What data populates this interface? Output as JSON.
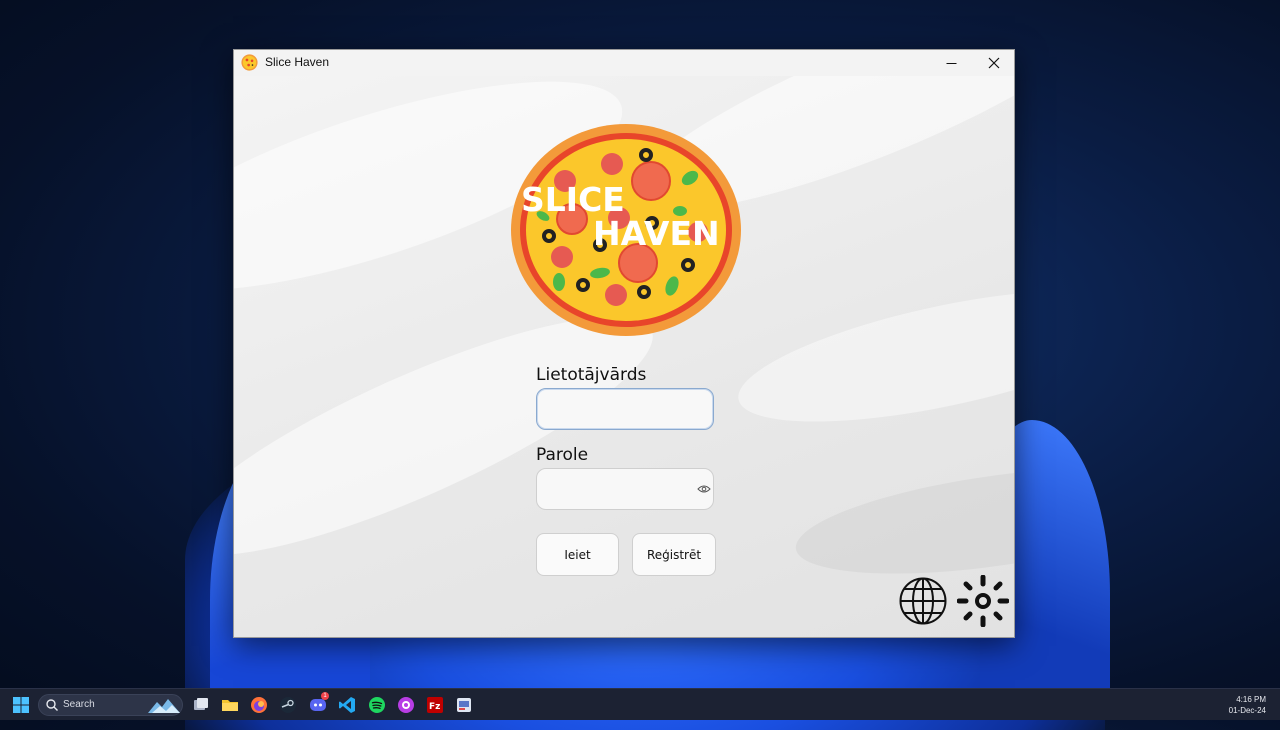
{
  "window": {
    "title": "Slice Haven",
    "minimize_symbol": "—",
    "close_symbol": "✕"
  },
  "logo": {
    "line1": "SLICE",
    "line2": "HAVEN"
  },
  "form": {
    "username_label": "Lietotājvārds",
    "username_value": "",
    "password_label": "Parole",
    "password_value": "",
    "login_button": "Ieiet",
    "register_button": "Reģistrēt"
  },
  "settings": {
    "language_icon": "globe-icon",
    "theme_icon": "sun-icon"
  },
  "taskbar": {
    "search_placeholder": "Search",
    "time": "4:16 PM",
    "date": "01-Dec-24",
    "discord_badge": "1",
    "apps": [
      "start-icon",
      "task-view-icon",
      "file-explorer-icon",
      "firefox-icon",
      "steam-icon",
      "discord-icon",
      "vscode-icon",
      "spotify-icon",
      "app-icon",
      "filezilla-icon",
      "app-icon-2"
    ]
  },
  "colors": {
    "pizza_crust": "#f39a3a",
    "pizza_sauce": "#e8452a",
    "pizza_cheese": "#fbc72b",
    "accent_focus": "#8aa9cf"
  }
}
